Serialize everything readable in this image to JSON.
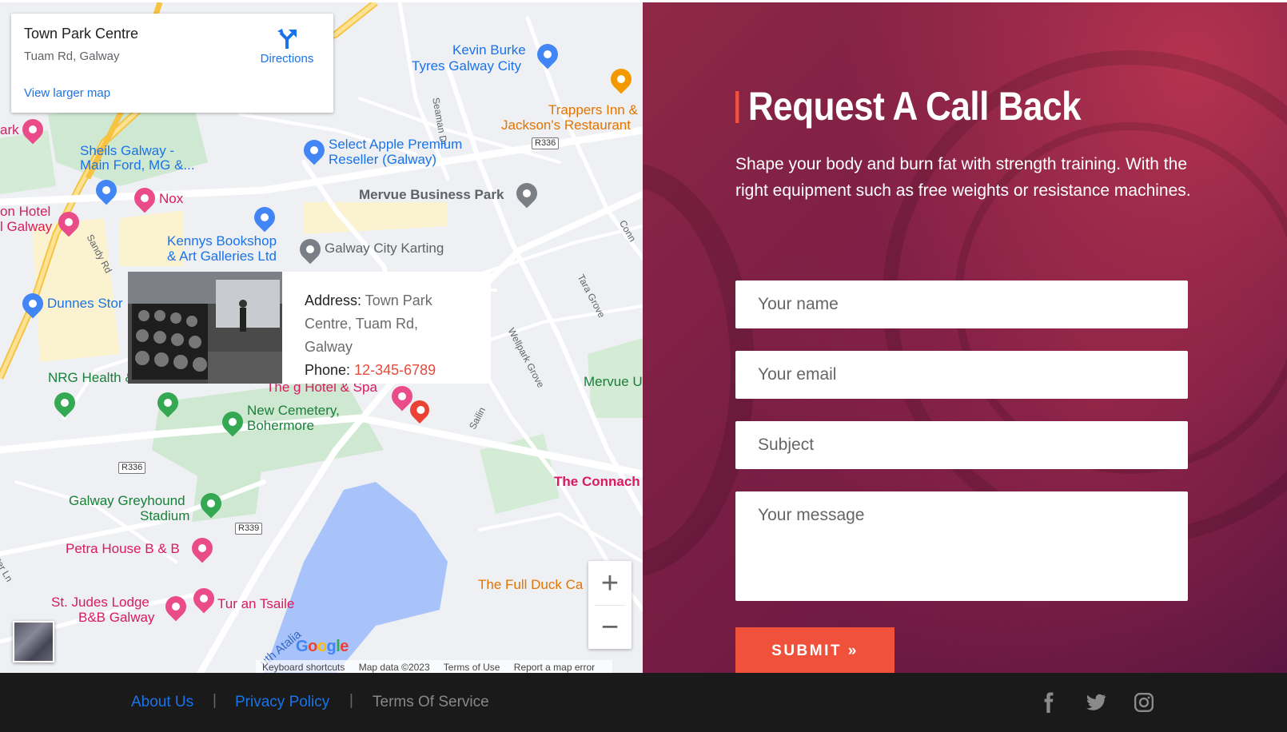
{
  "map": {
    "place_card": {
      "name": "Town Park Centre",
      "address": "Tuam Rd, Galway",
      "directions_label": "Directions",
      "larger_map_label": "View larger map"
    },
    "info_window": {
      "address_label": "Address:",
      "address_value": "Town Park Centre, Tuam Rd, Galway",
      "phone_label": "Phone:",
      "phone_value": "12-345-6789"
    },
    "labels": {
      "kevin_burke_1": "Kevin Burke",
      "kevin_burke_2": "Tyres Galway City",
      "trappers_1": "Trappers Inn &",
      "trappers_2": "Jackson's Restaurant",
      "seaman_dr": "Seaman Dr",
      "park": "ark",
      "sheils_1": "Sheils Galway -",
      "sheils_2": "Main Ford, MG &...",
      "select_apple_1": "Select Apple Premium",
      "select_apple_2": "Reseller (Galway)",
      "r336_a": "R336",
      "mervue_bp": "Mervue Business Park",
      "hotel_1": "on Hotel",
      "hotel_2": "l Galway",
      "nox": "Nox",
      "conn": "Conn",
      "sandy_rd": "Sandy Rd",
      "kennys_1": "Kennys Bookshop",
      "kennys_2": "& Art Galleries Ltd",
      "karting": "Galway City Karting",
      "tara_grove": "Tara Grove",
      "dunnes": "Dunnes Stor",
      "wellpark": "Wellpark Grove",
      "nrg": "NRG Health & Fitness",
      "g_hotel": "The g Hotel & Spa",
      "mervue_u": "Mervue U",
      "cemetery_1": "New Cemetery,",
      "cemetery_2": "Bohermore",
      "sailin": "Sailin",
      "r336_b": "R336",
      "connacht": "The Connach",
      "greyhound_1": "Galway Greyhound",
      "greyhound_2": "Stadium",
      "r339": "R339",
      "petra": "Petra House B & B",
      "full_duck": "The Full Duck Ca",
      "st_judes_1": "St. Judes Lodge",
      "st_judes_2": "B&B Galway",
      "tur_an": "Tur an Tsaile",
      "atalia": "uth Atalia",
      "ater_ln": "ater Ln"
    },
    "zoom_in": "+",
    "zoom_out": "−",
    "google_logo": "Google",
    "attribution": {
      "shortcuts": "Keyboard shortcuts",
      "map_data": "Map data ©2023",
      "terms": "Terms of Use",
      "report": "Report a map error"
    }
  },
  "form": {
    "title": "Request A Call Back",
    "description": "Shape your body and burn fat with strength training. With the right equipment such as free weights or resistance machines.",
    "name_placeholder": "Your name",
    "email_placeholder": "Your email",
    "subject_placeholder": "Subject",
    "message_placeholder": "Your message",
    "submit_label": "SUBMIT »",
    "accent_color": "#f0513b"
  },
  "footer": {
    "links": [
      {
        "label": "About Us"
      },
      {
        "label": "Privacy Policy"
      },
      {
        "label": "Terms Of Service"
      }
    ],
    "separator": "|",
    "social_icons": [
      "facebook-icon",
      "twitter-icon",
      "instagram-icon"
    ]
  }
}
